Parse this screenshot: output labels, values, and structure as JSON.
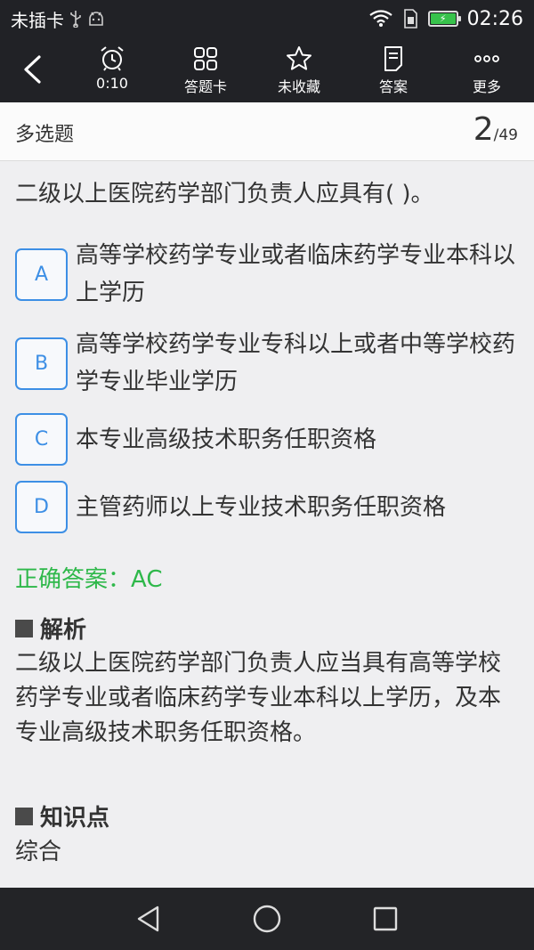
{
  "status_bar": {
    "carrier": "未插卡",
    "time": "02:26"
  },
  "toolbar": {
    "timer": "0:10",
    "answer_card": "答题卡",
    "favorite": "未收藏",
    "answer": "答案",
    "more": "更多"
  },
  "header": {
    "type": "多选题",
    "current": "2",
    "total": "/49"
  },
  "question": {
    "text": "二级以上医院药学部门负责人应具有(    )。",
    "options": [
      {
        "letter": "A",
        "text": "高等学校药学专业或者临床药学专业本科以上学历"
      },
      {
        "letter": "B",
        "text": "高等学校药学专业专科以上或者中等学校药学专业毕业学历"
      },
      {
        "letter": "C",
        "text": "本专业高级技术职务任职资格"
      },
      {
        "letter": "D",
        "text": "主管药师以上专业技术职务任职资格"
      }
    ]
  },
  "answer": {
    "text": "正确答案：AC"
  },
  "analysis": {
    "title": "解析",
    "body": "二级以上医院药学部门负责人应当具有高等学校药学专业或者临床药学专业本科以上学历，及本专业高级技术职务任职资格。"
  },
  "knowledge": {
    "title": "知识点",
    "body": "综合"
  },
  "colors": {
    "accent": "#3d8fe5",
    "correct": "#2eb84a",
    "bar": "#212226"
  }
}
